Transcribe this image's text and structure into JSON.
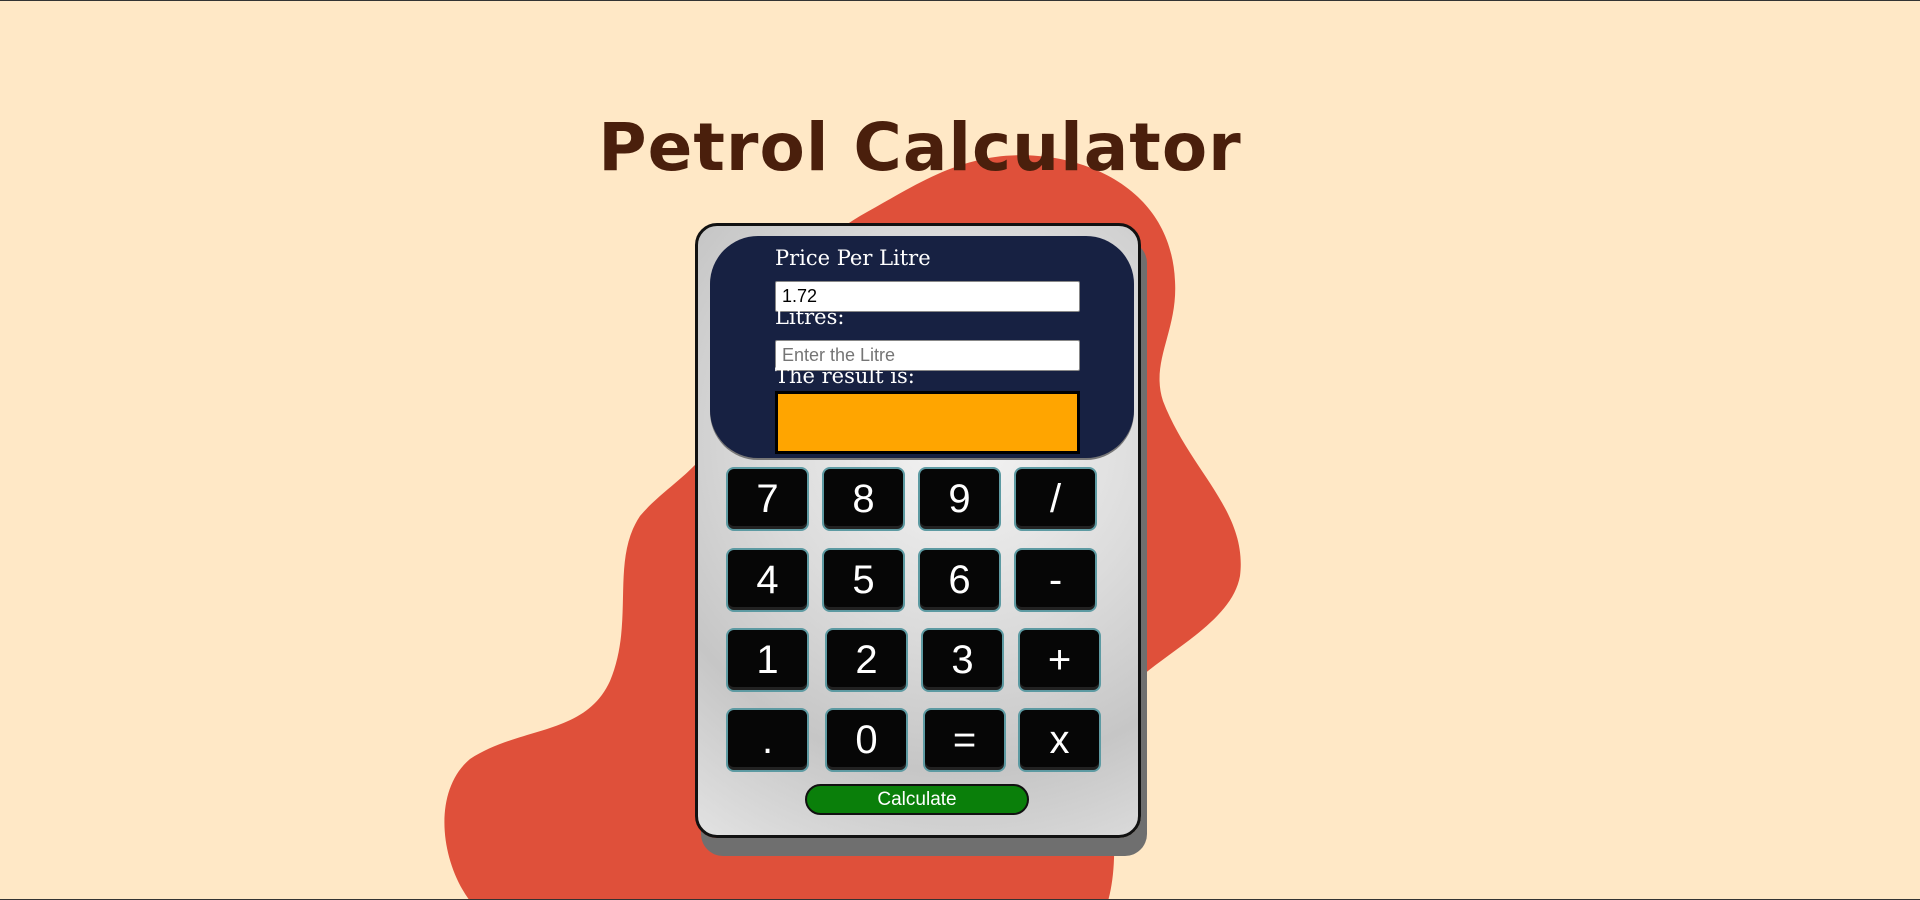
{
  "page": {
    "title": "Petrol Calculator"
  },
  "calculator": {
    "price_label": "Price Per Litre",
    "price_value": "1.72",
    "litres_label": "Litres:",
    "litres_placeholder": "Enter the Litre",
    "litres_value": "",
    "result_label": "The result is:",
    "result_value": "",
    "keys": [
      "7",
      "8",
      "9",
      "/",
      "4",
      "5",
      "6",
      "-",
      "1",
      "2",
      "3",
      "+",
      ".",
      "0",
      "=",
      "x"
    ],
    "calculate_label": "Calculate"
  },
  "colors": {
    "background": "#ffe8c6",
    "blob": "#df503a",
    "title": "#4a1f0c",
    "screen": "#172142",
    "result_box": "#ffa500",
    "keys": "#060606",
    "calculate_button": "#0a7f0a"
  }
}
